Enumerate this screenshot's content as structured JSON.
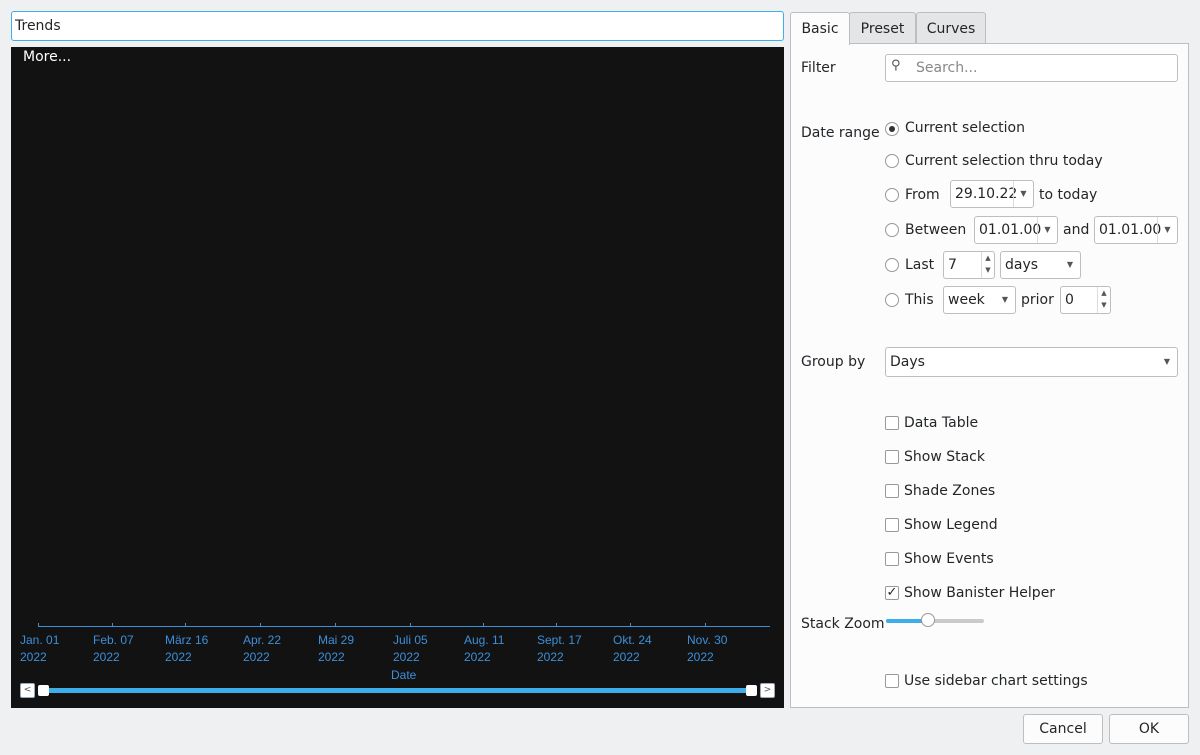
{
  "title_input": {
    "value": "Trends"
  },
  "chart": {
    "more_label": "More...",
    "xlabel": "Date",
    "ticks": [
      {
        "l1": "Jan. 01",
        "l2": "2022"
      },
      {
        "l1": "Feb. 07",
        "l2": "2022"
      },
      {
        "l1": "März 16",
        "l2": "2022"
      },
      {
        "l1": "Apr. 22",
        "l2": "2022"
      },
      {
        "l1": "Mai 29",
        "l2": "2022"
      },
      {
        "l1": "Juli 05",
        "l2": "2022"
      },
      {
        "l1": "Aug. 11",
        "l2": "2022"
      },
      {
        "l1": "Sept. 17",
        "l2": "2022"
      },
      {
        "l1": "Okt. 24",
        "l2": "2022"
      },
      {
        "l1": "Nov. 30",
        "l2": "2022"
      }
    ],
    "scroll_left": "<",
    "scroll_right": ">",
    "accent": "#3daee9"
  },
  "tabs": [
    {
      "label": "Basic"
    },
    {
      "label": "Preset"
    },
    {
      "label": "Curves"
    }
  ],
  "basic": {
    "filter_label": "Filter",
    "search_placeholder": "Search...",
    "date_range_label": "Date range",
    "opt_current": "Current selection",
    "opt_thru": "Current selection thru today",
    "opt_from": "From",
    "from_date": "29.10.22",
    "to_today": "to today",
    "opt_between": "Between",
    "between_from": "01.01.00",
    "and": "and",
    "between_to": "01.01.00",
    "opt_last": "Last",
    "last_value": "7",
    "last_unit": "days",
    "opt_this": "This",
    "this_unit": "week",
    "prior": "prior",
    "prior_value": "0",
    "selected_range": "Current selection",
    "group_by_label": "Group by",
    "group_by_value": "Days",
    "checkboxes": [
      {
        "label": "Data Table",
        "checked": false
      },
      {
        "label": "Show Stack",
        "checked": false
      },
      {
        "label": "Shade Zones",
        "checked": false
      },
      {
        "label": "Show Legend",
        "checked": false
      },
      {
        "label": "Show Events",
        "checked": false
      },
      {
        "label": "Show Banister Helper",
        "checked": true
      }
    ],
    "stack_zoom_label": "Stack Zoom",
    "stack_zoom_level": 0.43,
    "sidebar_settings": {
      "label": "Use sidebar chart settings",
      "checked": false
    }
  },
  "buttons": {
    "cancel": "Cancel",
    "ok": "OK"
  }
}
